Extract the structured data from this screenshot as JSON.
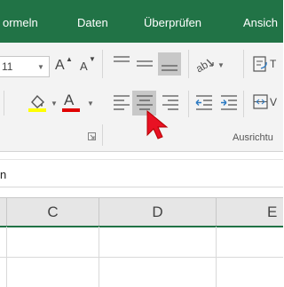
{
  "tabs": [
    {
      "label": "ormeln"
    },
    {
      "label": "Daten"
    },
    {
      "label": "Überprüfen"
    },
    {
      "label": "Ansich"
    }
  ],
  "font": {
    "size_value": "11",
    "grow_label": "A",
    "shrink_label": "A",
    "font_color_label": "A"
  },
  "alignment": {
    "wrap_text_label": "T",
    "merge_label": "V",
    "group_label": "Ausrichtu"
  },
  "formula_bar": {
    "namebox_fragment": "n"
  },
  "columns": [
    {
      "label": "C"
    },
    {
      "label": "D"
    },
    {
      "label": "E"
    }
  ],
  "colors": {
    "ribbon_green": "#217346",
    "highlight_yellow": "#ffff00",
    "font_red": "#e00000",
    "cursor_red": "#e81123",
    "selected_button": "#c8c8c8"
  },
  "icons": [
    "font-size-dropdown-icon",
    "increase-font-size-icon",
    "decrease-font-size-icon",
    "fill-color-icon",
    "font-color-icon",
    "align-top-icon",
    "align-middle-icon",
    "align-bottom-icon",
    "align-left-icon",
    "align-center-icon",
    "align-right-icon",
    "orientation-icon",
    "decrease-indent-icon",
    "increase-indent-icon",
    "wrap-text-icon",
    "merge-center-icon",
    "dialog-launcher-icon",
    "mouse-cursor-icon"
  ]
}
